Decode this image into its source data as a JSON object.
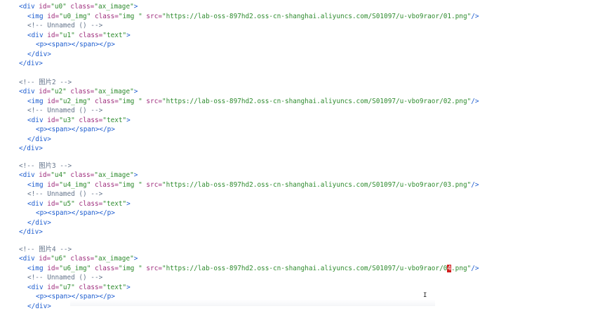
{
  "blocks": [
    {
      "comment": "",
      "div_open": {
        "lt": "<",
        "tag": "div",
        "sp1": " ",
        "id_attr": "id=",
        "id": "\"u0\"",
        "sp2": " ",
        "class_attr": "class=",
        "cls": "\"ax_image\"",
        "gt": ">"
      },
      "img": {
        "lt": "<",
        "tag": "img",
        "sp1": " ",
        "id_attr": "id=",
        "id": "\"u0_img\"",
        "sp2": " ",
        "class_attr": "class=",
        "cls": "\"img \"",
        "sp3": " ",
        "src_attr": "src=",
        "src_pre": "\"https://lab-oss-897hd2.oss-cn-shanghai.aliyuncs.com/S01097/u-vbo9raor/01",
        "src_hl": "",
        "src_post": ".png\"",
        "end": "/>"
      },
      "unnamed": "<!-- Unnamed () -->",
      "div_text_open": {
        "lt": "<",
        "tag": "div",
        "sp1": " ",
        "id_attr": "id=",
        "id": "\"u1\"",
        "sp2": " ",
        "class_attr": "class=",
        "cls": "\"text\"",
        "gt": ">"
      },
      "p_span": "<p><span></span></p>",
      "div_close_inner": "</div>",
      "div_close_outer": "</div>"
    },
    {
      "comment": "<!-- 图片2 -->",
      "div_open": {
        "lt": "<",
        "tag": "div",
        "sp1": " ",
        "id_attr": "id=",
        "id": "\"u2\"",
        "sp2": " ",
        "class_attr": "class=",
        "cls": "\"ax_image\"",
        "gt": ">"
      },
      "img": {
        "lt": "<",
        "tag": "img",
        "sp1": " ",
        "id_attr": "id=",
        "id": "\"u2_img\"",
        "sp2": " ",
        "class_attr": "class=",
        "cls": "\"img \"",
        "sp3": " ",
        "src_attr": "src=",
        "src_pre": "\"https://lab-oss-897hd2.oss-cn-shanghai.aliyuncs.com/S01097/u-vbo9raor/02",
        "src_hl": "",
        "src_post": ".png\"",
        "end": "/>"
      },
      "unnamed": "<!-- Unnamed () -->",
      "div_text_open": {
        "lt": "<",
        "tag": "div",
        "sp1": " ",
        "id_attr": "id=",
        "id": "\"u3\"",
        "sp2": " ",
        "class_attr": "class=",
        "cls": "\"text\"",
        "gt": ">"
      },
      "p_span": "<p><span></span></p>",
      "div_close_inner": "</div>",
      "div_close_outer": "</div>"
    },
    {
      "comment": "<!-- 图片3 -->",
      "div_open": {
        "lt": "<",
        "tag": "div",
        "sp1": " ",
        "id_attr": "id=",
        "id": "\"u4\"",
        "sp2": " ",
        "class_attr": "class=",
        "cls": "\"ax_image\"",
        "gt": ">"
      },
      "img": {
        "lt": "<",
        "tag": "img",
        "sp1": " ",
        "id_attr": "id=",
        "id": "\"u4_img\"",
        "sp2": " ",
        "class_attr": "class=",
        "cls": "\"img \"",
        "sp3": " ",
        "src_attr": "src=",
        "src_pre": "\"https://lab-oss-897hd2.oss-cn-shanghai.aliyuncs.com/S01097/u-vbo9raor/03",
        "src_hl": "",
        "src_post": ".png\"",
        "end": "/>"
      },
      "unnamed": "<!-- Unnamed () -->",
      "div_text_open": {
        "lt": "<",
        "tag": "div",
        "sp1": " ",
        "id_attr": "id=",
        "id": "\"u5\"",
        "sp2": " ",
        "class_attr": "class=",
        "cls": "\"text\"",
        "gt": ">"
      },
      "p_span": "<p><span></span></p>",
      "div_close_inner": "</div>",
      "div_close_outer": "</div>"
    },
    {
      "comment": "<!-- 图片4 -->",
      "div_open": {
        "lt": "<",
        "tag": "div",
        "sp1": " ",
        "id_attr": "id=",
        "id": "\"u6\"",
        "sp2": " ",
        "class_attr": "class=",
        "cls": "\"ax_image\"",
        "gt": ">"
      },
      "img": {
        "lt": "<",
        "tag": "img",
        "sp1": " ",
        "id_attr": "id=",
        "id": "\"u6_img\"",
        "sp2": " ",
        "class_attr": "class=",
        "cls": "\"img \"",
        "sp3": " ",
        "src_attr": "src=",
        "src_pre": "\"https://lab-oss-897hd2.oss-cn-shanghai.aliyuncs.com/S01097/u-vbo9raor/0",
        "src_hl": "4",
        "src_post": ".png\"",
        "end": "/>"
      },
      "unnamed": "<!-- Unnamed () -->",
      "div_text_open": {
        "lt": "<",
        "tag": "div",
        "sp1": " ",
        "id_attr": "id=",
        "id": "\"u7\"",
        "sp2": " ",
        "class_attr": "class=",
        "cls": "\"text\"",
        "gt": ">"
      },
      "p_span": "<p><span></span></p>",
      "div_close_inner": "</div>",
      "div_close_outer": ""
    }
  ],
  "colors": {
    "tag": "#1c5ccf",
    "attr": "#9e2c7c",
    "value": "#2e8b2e",
    "comment": "#64748b",
    "highlight": "#d11c1c"
  },
  "icons": {
    "mouse": "text-cursor-icon"
  }
}
